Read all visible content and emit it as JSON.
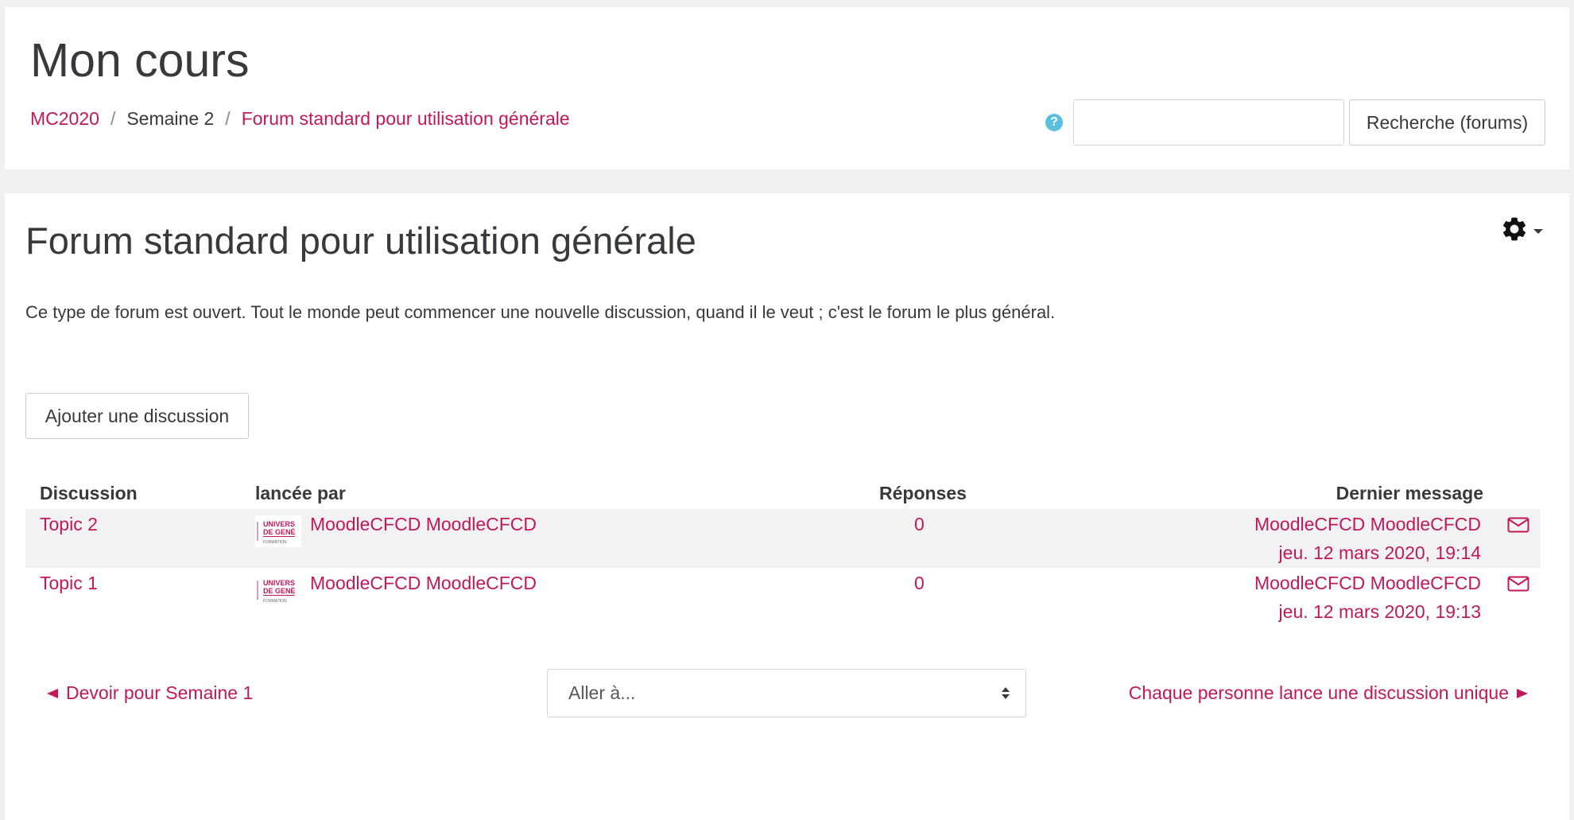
{
  "header": {
    "title": "Mon cours",
    "breadcrumb": [
      "MC2020",
      "Semaine 2",
      "Forum standard pour utilisation générale"
    ],
    "search_placeholder": "",
    "search_button": "Recherche (forums)",
    "help_icon": "question-circle-icon"
  },
  "forum": {
    "title": "Forum standard pour utilisation générale",
    "intro": "Ce type de forum est ouvert. Tout le monde peut commencer une nouvelle discussion, quand il le veut ; c'est le forum le plus général.",
    "add_button": "Ajouter une discussion",
    "columns": [
      "Discussion",
      "lancée par",
      "Réponses",
      "Dernier message"
    ],
    "rows": [
      {
        "topic": "Topic 2",
        "author": "MoodleCFCD MoodleCFCD",
        "replies": "0",
        "last_author": "MoodleCFCD MoodleCFCD",
        "last_date": "jeu. 12 mars 2020, 19:14"
      },
      {
        "topic": "Topic 1",
        "author": "MoodleCFCD MoodleCFCD",
        "replies": "0",
        "last_author": "MoodleCFCD MoodleCFCD",
        "last_date": "jeu. 12 mars 2020, 19:13"
      }
    ]
  },
  "nav": {
    "prev": "Devoir pour Semaine 1",
    "jump": "Aller à...",
    "next": "Chaque personne lance une discussion unique"
  },
  "colors": {
    "link": "#c2185b",
    "help": "#5bc0de",
    "row_stripe": "#f2f2f2"
  }
}
